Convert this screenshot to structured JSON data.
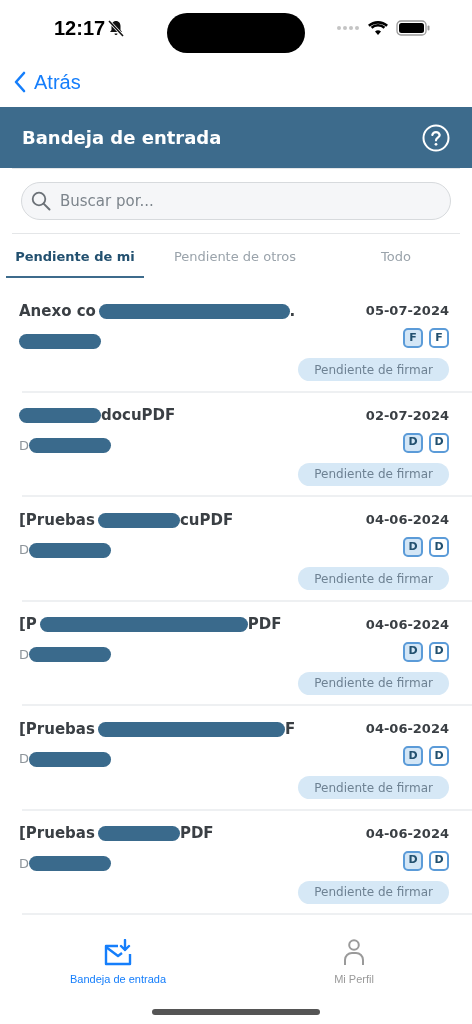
{
  "status_bar": {
    "time": "12:17"
  },
  "nav": {
    "back": "Atrás"
  },
  "header": {
    "title": "Bandeja de entrada"
  },
  "search": {
    "placeholder": "Buscar por..."
  },
  "tabs": [
    {
      "label": "Pendiente de mi",
      "selected": true
    },
    {
      "label": "Pendiente de otros",
      "selected": false
    },
    {
      "label": "Todo",
      "selected": false
    }
  ],
  "items": [
    {
      "title": [
        {
          "kind": "text",
          "text": "Anexo co"
        },
        {
          "kind": "redaction-long"
        },
        {
          "kind": "text",
          "text": "."
        }
      ],
      "subtitle": [
        {
          "kind": "redaction-medium"
        }
      ],
      "date": "05-07-2024",
      "badges": [
        {
          "text": "F",
          "filled": true
        },
        {
          "text": "F",
          "filled": false
        }
      ],
      "status": "Pendiente de firmar"
    },
    {
      "title": [
        {
          "kind": "redaction-medium"
        },
        {
          "kind": "text",
          "text": "docuPDF"
        }
      ],
      "subtitle": [
        {
          "kind": "text",
          "text": "D"
        },
        {
          "kind": "redaction-medium"
        }
      ],
      "date": "02-07-2024",
      "badges": [
        {
          "text": "D",
          "filled": true
        },
        {
          "text": "D",
          "filled": false
        }
      ],
      "status": "Pendiente de firmar"
    },
    {
      "title": [
        {
          "kind": "text",
          "text": "[Pruebas"
        },
        {
          "kind": "redaction-medium"
        },
        {
          "kind": "text",
          "text": "cuPDF"
        }
      ],
      "subtitle": [
        {
          "kind": "text",
          "text": "D"
        },
        {
          "kind": "redaction-medium"
        }
      ],
      "date": "04-06-2024",
      "badges": [
        {
          "text": "D",
          "filled": true
        },
        {
          "text": "D",
          "filled": false
        }
      ],
      "status": "Pendiente de firmar"
    },
    {
      "title": [
        {
          "kind": "text",
          "text": "[P"
        },
        {
          "kind": "redaction-long"
        },
        {
          "kind": "text",
          "text": "PDF"
        }
      ],
      "subtitle": [
        {
          "kind": "text",
          "text": "D"
        },
        {
          "kind": "redaction-medium"
        }
      ],
      "date": "04-06-2024",
      "badges": [
        {
          "text": "D",
          "filled": true
        },
        {
          "text": "D",
          "filled": false
        }
      ],
      "status": "Pendiente de firmar"
    },
    {
      "title": [
        {
          "kind": "text",
          "text": "[Pruebas"
        },
        {
          "kind": "redaction-long"
        },
        {
          "kind": "text",
          "text": "F"
        }
      ],
      "subtitle": [
        {
          "kind": "text",
          "text": "D"
        },
        {
          "kind": "redaction-medium"
        }
      ],
      "date": "04-06-2024",
      "badges": [
        {
          "text": "D",
          "filled": true
        },
        {
          "text": "D",
          "filled": false
        }
      ],
      "status": "Pendiente de firmar"
    },
    {
      "title": [
        {
          "kind": "text",
          "text": "[Pruebas"
        },
        {
          "kind": "redaction-medium"
        },
        {
          "kind": "text",
          "text": "PDF"
        }
      ],
      "subtitle": [
        {
          "kind": "text",
          "text": "D"
        },
        {
          "kind": "redaction-medium"
        }
      ],
      "date": "04-06-2024",
      "badges": [
        {
          "text": "D",
          "filled": true
        },
        {
          "text": "D",
          "filled": false
        }
      ],
      "status": "Pendiente de firmar"
    }
  ],
  "bottom_tabs": [
    {
      "label": "Bandeja de entrada",
      "kind": "inbox",
      "selected": true
    },
    {
      "label": "Mi Perfil",
      "kind": "profile",
      "selected": false
    }
  ]
}
